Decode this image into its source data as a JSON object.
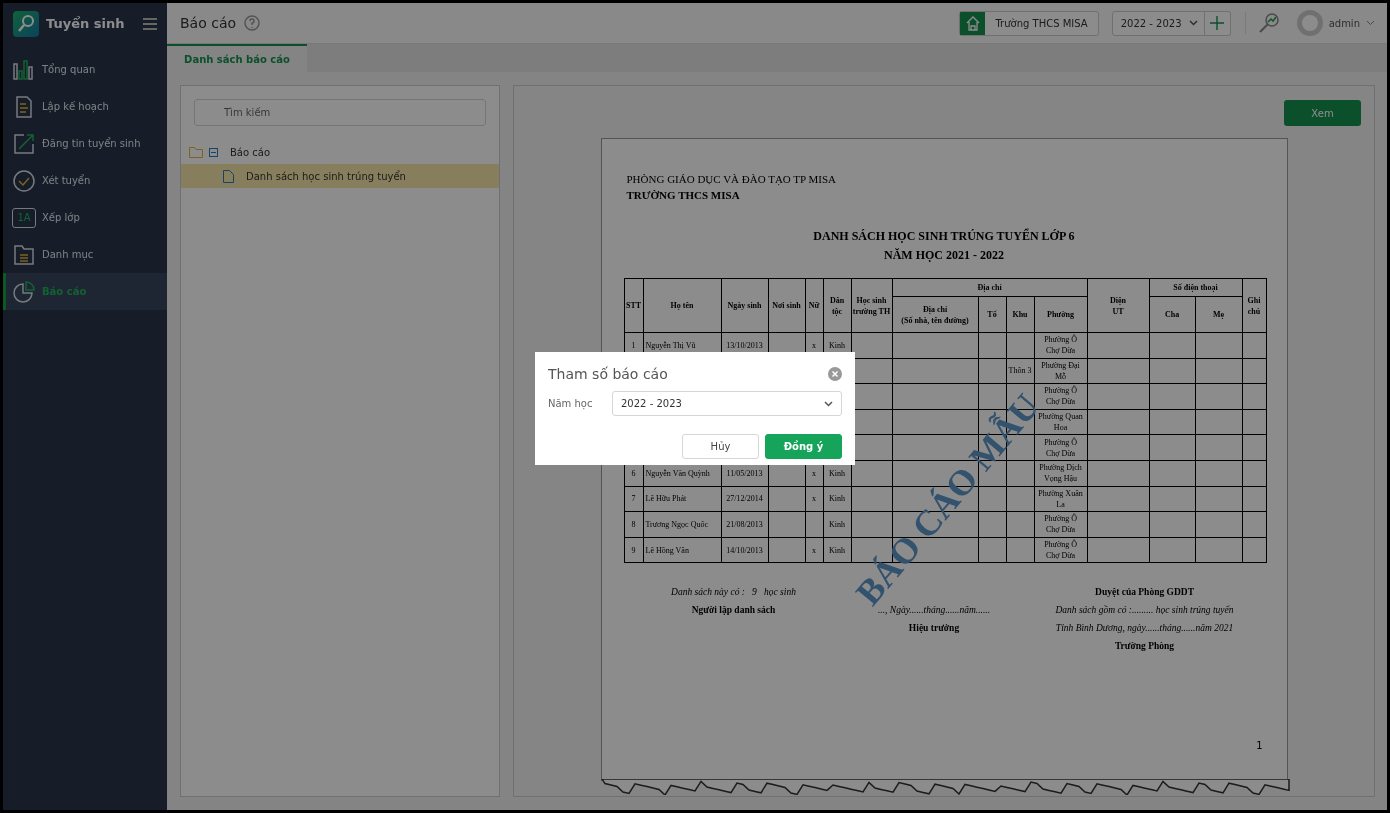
{
  "sidebar": {
    "app_name": "Tuyển sinh",
    "items": [
      {
        "label": "Tổng quan",
        "selected": false
      },
      {
        "label": "Lập kế hoạch",
        "selected": false
      },
      {
        "label": "Đăng tin tuyển sinh",
        "selected": false
      },
      {
        "label": "Xét tuyển",
        "selected": false
      },
      {
        "label": "Xếp lớp",
        "selected": false,
        "icon_text": "1A"
      },
      {
        "label": "Danh mục",
        "selected": false
      },
      {
        "label": "Báo cáo",
        "selected": true
      }
    ]
  },
  "topbar": {
    "title": "Báo cáo",
    "school": "Trường THCS MISA",
    "year": "2022 - 2023",
    "user": "admin"
  },
  "tabs": [
    {
      "label": "Danh sách báo cáo",
      "selected": true
    }
  ],
  "tree": {
    "search_placeholder": "Tìm kiếm",
    "items": [
      {
        "label": "Báo cáo",
        "expanded": true,
        "selected": false,
        "children": [
          {
            "label": "Danh sách học sinh trúng tuyển",
            "selected": true
          }
        ]
      }
    ]
  },
  "view_button": "Xem",
  "report": {
    "agency": "PHÒNG GIÁO DỤC VÀ ĐÀO TẠO TP MISA",
    "school": "TRƯỜNG THCS MISA",
    "title": "DANH SÁCH HỌC SINH TRÚNG TUYỂN LỚP 6",
    "subtitle": "NĂM HỌC 2021 - 2022",
    "columns": [
      {
        "label": "STT"
      },
      {
        "label": "Họ tên"
      },
      {
        "label": "Ngày sinh"
      },
      {
        "label": "Nơi sinh"
      },
      {
        "label": "Nữ"
      },
      {
        "label": "Dân tộc"
      },
      {
        "label": "Học sinh trường TH"
      },
      {
        "label": "Địa chỉ",
        "children": [
          {
            "label": "Địa chỉ\n(Số nhà, tên đường)"
          },
          {
            "label": "Tổ"
          },
          {
            "label": "Khu"
          },
          {
            "label": "Phường"
          }
        ]
      },
      {
        "label": "Diện\nUT"
      },
      {
        "label": "Số điện thoại",
        "children": [
          {
            "label": "Cha"
          },
          {
            "label": "Mẹ"
          }
        ]
      },
      {
        "label": "Ghi chú"
      }
    ],
    "rows": [
      {
        "stt": "1",
        "name": "Nguyễn Thị Vũ",
        "dob": "13/10/2013",
        "female": "x",
        "ethnicity": "Kinh",
        "ward": "Phường Ô Chợ Dừa"
      },
      {
        "khu": "Thôn 3",
        "ward": "Phường Đại Mỗ"
      },
      {
        "ward": "Phường Ô Chợ Dừa"
      },
      {
        "ward": "Phường Quan Hoa"
      },
      {
        "ward": "Phường Ô Chợ Dừa"
      },
      {
        "stt": "6",
        "name": "Nguyễn Văn Quỳnh",
        "dob": "11/05/2013",
        "female": "x",
        "ethnicity": "Kinh",
        "ward": "Phường Dịch Vọng Hậu"
      },
      {
        "stt": "7",
        "name": "Lê Hữu Phát",
        "dob": "27/12/2014",
        "female": "x",
        "ethnicity": "Kinh",
        "ward": "Phường Xuân La"
      },
      {
        "stt": "8",
        "name": "Trương Ngọc Quốc",
        "dob": "21/08/2013",
        "ethnicity": "Kinh",
        "ward": "Phường Ô Chợ Dừa"
      },
      {
        "stt": "9",
        "name": "Lê Hồng Vân",
        "dob": "14/10/2013",
        "female": "x",
        "ethnicity": "Kinh",
        "ward": "Phường Ô Chợ Dừa"
      }
    ],
    "footer": [
      {
        "lines": [
          {
            "text": "Danh sách này có :   9   học sinh",
            "kind": "italic"
          },
          {
            "text": "Người lập danh sách",
            "kind": "bold"
          }
        ]
      },
      {
        "lines": [
          {
            "text": "..., Ngày......tháng......năm......",
            "kind": "italic"
          },
          {
            "text": "Hiệu trưởng",
            "kind": "bold"
          }
        ]
      },
      {
        "lines": [
          {
            "text": "Duyệt của Phòng GDDT",
            "kind": "bold"
          },
          {
            "text": "Danh sách gồm có :......... học sinh trúng tuyển",
            "kind": "italic"
          },
          {
            "text": "Tỉnh Bình Dương, ngày......tháng......năm 2021",
            "kind": "italic"
          },
          {
            "text": "Trường Phòng",
            "kind": "bold"
          }
        ]
      }
    ],
    "page_number": "1",
    "stamp": "BÁO CÁO MẪU"
  },
  "dialog": {
    "title": "Tham số báo cáo",
    "field_label": "Năm học",
    "field_value": "2022 - 2023",
    "buttons": [
      {
        "label": "Hủy",
        "kind": "secondary"
      },
      {
        "label": "Đồng ý",
        "kind": "primary"
      }
    ]
  }
}
